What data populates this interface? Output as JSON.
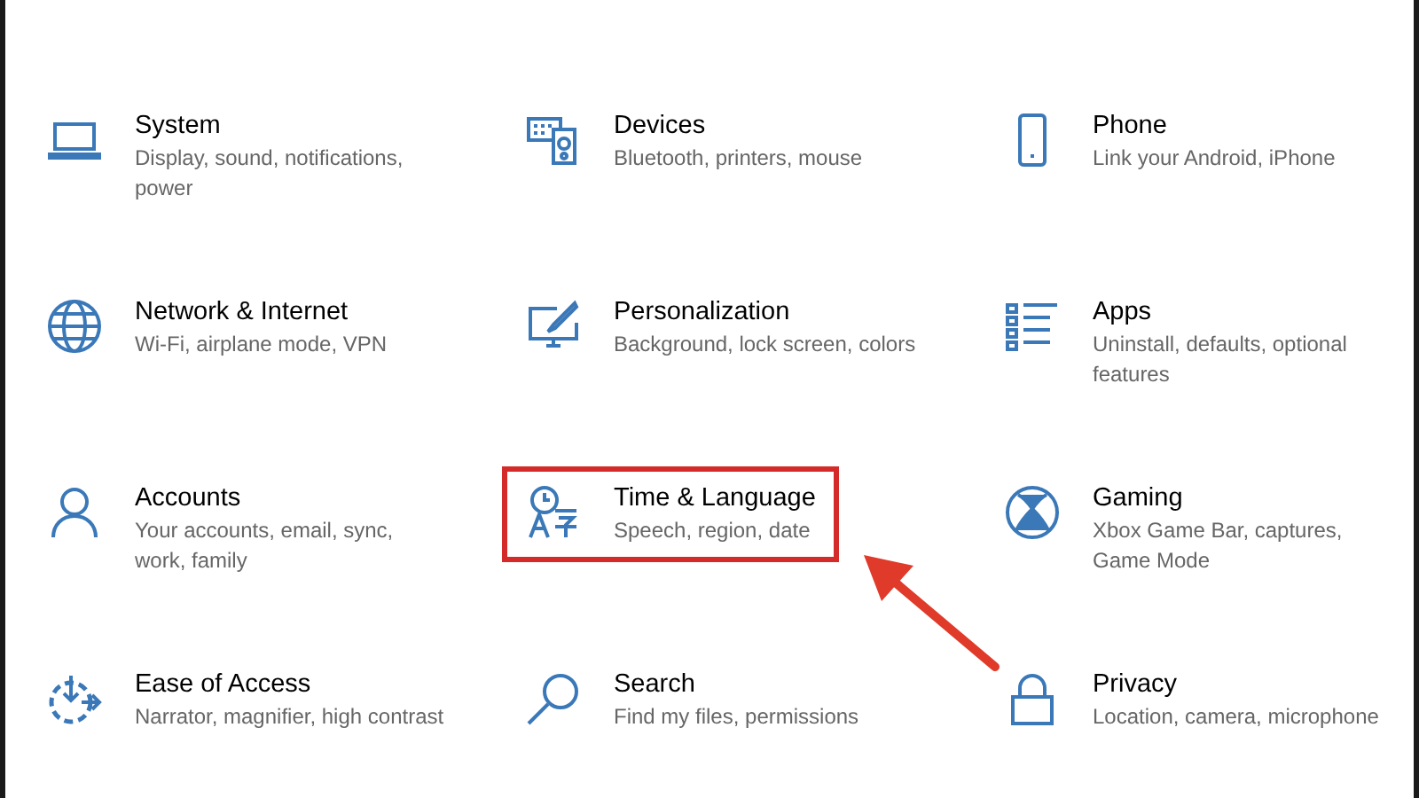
{
  "categories": [
    {
      "title": "System",
      "description": "Display, sound, notifications, power",
      "highlighted": false
    },
    {
      "title": "Devices",
      "description": "Bluetooth, printers, mouse",
      "highlighted": false
    },
    {
      "title": "Phone",
      "description": "Link your Android, iPhone",
      "highlighted": false
    },
    {
      "title": "Network & Internet",
      "description": "Wi-Fi, airplane mode, VPN",
      "highlighted": false
    },
    {
      "title": "Personalization",
      "description": "Background, lock screen, colors",
      "highlighted": false
    },
    {
      "title": "Apps",
      "description": "Uninstall, defaults, optional features",
      "highlighted": false
    },
    {
      "title": "Accounts",
      "description": "Your accounts, email, sync, work, family",
      "highlighted": false
    },
    {
      "title": "Time & Language",
      "description": "Speech, region, date",
      "highlighted": true
    },
    {
      "title": "Gaming",
      "description": "Xbox Game Bar, captures, Game Mode",
      "highlighted": false
    },
    {
      "title": "Ease of Access",
      "description": "Narrator, magnifier, high contrast",
      "highlighted": false
    },
    {
      "title": "Search",
      "description": "Find my files, permissions",
      "highlighted": false
    },
    {
      "title": "Privacy",
      "description": "Location, camera, microphone",
      "highlighted": false
    }
  ]
}
